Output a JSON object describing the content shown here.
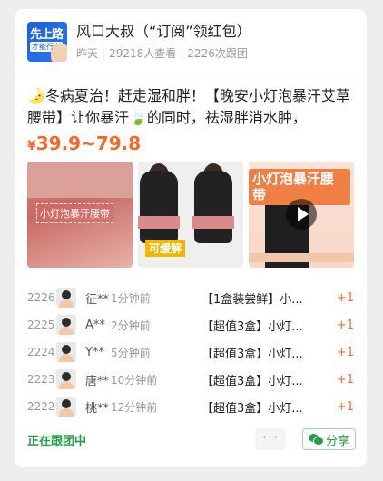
{
  "header": {
    "avatar_line1": "先上路",
    "avatar_line2": "才能行者",
    "title": "风口大叔（“订阅”领红包）",
    "posted": "昨天",
    "views": "29218人查看",
    "joins": "2226次跟团"
  },
  "post": {
    "description": "🌛冬病夏治！赶走湿和胖！【晚安小灯泡暴汗艾草腰带】让你暴汗🍃的同时，祛湿胖消水肿，无“湿...",
    "price_currency": "¥",
    "price_range": "39.9~79.8"
  },
  "images": [
    {
      "icon": "product-photo",
      "label": "小灯泡暴汗腰带"
    },
    {
      "icon": "product-photo",
      "label": "可缓解"
    },
    {
      "icon": "video-thumbnail",
      "label": "小灯泡暴汗腰带"
    }
  ],
  "orders": [
    {
      "num": "2226",
      "name": "征**",
      "time": "1分钟前",
      "product": "【1盒装尝鲜】小...",
      "count": "+1"
    },
    {
      "num": "2225",
      "name": "A**",
      "time": "2分钟前",
      "product": "【超值3盒】小灯...",
      "count": "+1"
    },
    {
      "num": "2224",
      "name": "Y**",
      "time": "5分钟前",
      "product": "【超值3盒】小灯...",
      "count": "+1"
    },
    {
      "num": "2223",
      "name": "唐**",
      "time": "10分钟前",
      "product": "【超值3盒】小灯...",
      "count": "+1"
    },
    {
      "num": "2222",
      "name": "桃**",
      "time": "12分钟前",
      "product": "【超值3盒】小灯...",
      "count": "+1"
    }
  ],
  "footer": {
    "status": "正在跟团中",
    "more": "···",
    "share": "分享"
  },
  "colors": {
    "accent": "#f56a2a",
    "green": "#20a045"
  }
}
